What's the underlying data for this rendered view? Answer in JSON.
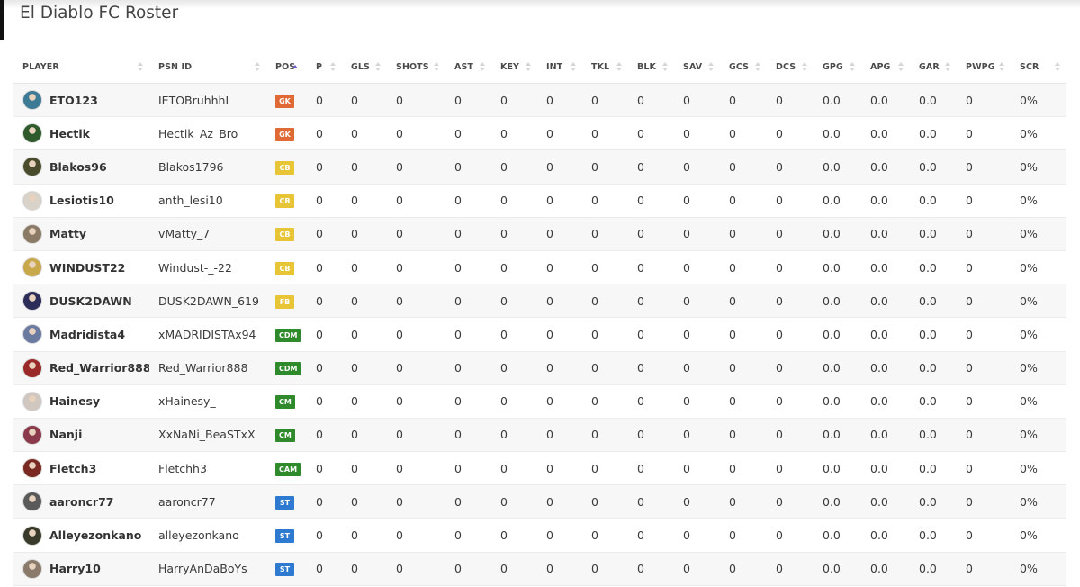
{
  "page": {
    "title": "El Diablo FC Roster"
  },
  "columns": {
    "player": "PLAYER",
    "psn": "PSN ID",
    "pos": "POS",
    "p": "P",
    "gls": "GLS",
    "shots": "SHOTS",
    "ast": "AST",
    "key": "KEY",
    "int": "INT",
    "tkl": "TKL",
    "blk": "BLK",
    "sav": "SAV",
    "gcs": "GCS",
    "dcs": "DCS",
    "gpg": "GPG",
    "apg": "APG",
    "gar": "GAR",
    "pwpg": "PWPG",
    "scr": "SCR"
  },
  "sort": {
    "column": "POS",
    "direction": "ascending"
  },
  "position_colors": {
    "GK": "#e06a35",
    "CB": "#e8c537",
    "FB": "#e8c537",
    "CDM": "#2f8a2b",
    "CM": "#2f8a2b",
    "CAM": "#2f8a2b",
    "ST": "#2e7ad0"
  },
  "players": [
    {
      "name": "ETO123",
      "psn": "IETOBruhhhI",
      "pos": "GK",
      "avatar_color": "#3d7a95",
      "p": "0",
      "gls": "0",
      "shots": "0",
      "ast": "0",
      "key": "0",
      "int": "0",
      "tkl": "0",
      "blk": "0",
      "sav": "0",
      "gcs": "0",
      "dcs": "0",
      "gpg": "0.0",
      "apg": "0.0",
      "gar": "0.0",
      "pwpg": "0",
      "scr": "0%"
    },
    {
      "name": "Hectik",
      "psn": "Hectik_Az_Bro",
      "pos": "GK",
      "avatar_color": "#2f5a2c",
      "p": "0",
      "gls": "0",
      "shots": "0",
      "ast": "0",
      "key": "0",
      "int": "0",
      "tkl": "0",
      "blk": "0",
      "sav": "0",
      "gcs": "0",
      "dcs": "0",
      "gpg": "0.0",
      "apg": "0.0",
      "gar": "0.0",
      "pwpg": "0",
      "scr": "0%"
    },
    {
      "name": "Blakos96",
      "psn": "Blakos1796",
      "pos": "CB",
      "avatar_color": "#4a4a2c",
      "p": "0",
      "gls": "0",
      "shots": "0",
      "ast": "0",
      "key": "0",
      "int": "0",
      "tkl": "0",
      "blk": "0",
      "sav": "0",
      "gcs": "0",
      "dcs": "0",
      "gpg": "0.0",
      "apg": "0.0",
      "gar": "0.0",
      "pwpg": "0",
      "scr": "0%"
    },
    {
      "name": "Lesiotis10",
      "psn": "anth_lesi10",
      "pos": "CB",
      "avatar_color": "#d8d2c8",
      "p": "0",
      "gls": "0",
      "shots": "0",
      "ast": "0",
      "key": "0",
      "int": "0",
      "tkl": "0",
      "blk": "0",
      "sav": "0",
      "gcs": "0",
      "dcs": "0",
      "gpg": "0.0",
      "apg": "0.0",
      "gar": "0.0",
      "pwpg": "0",
      "scr": "0%"
    },
    {
      "name": "Matty",
      "psn": "vMatty_7",
      "pos": "CB",
      "avatar_color": "#8a7a66",
      "p": "0",
      "gls": "0",
      "shots": "0",
      "ast": "0",
      "key": "0",
      "int": "0",
      "tkl": "0",
      "blk": "0",
      "sav": "0",
      "gcs": "0",
      "dcs": "0",
      "gpg": "0.0",
      "apg": "0.0",
      "gar": "0.0",
      "pwpg": "0",
      "scr": "0%"
    },
    {
      "name": "WINDUST22",
      "psn": "Windust-_-22",
      "pos": "CB",
      "avatar_color": "#c9a84a",
      "p": "0",
      "gls": "0",
      "shots": "0",
      "ast": "0",
      "key": "0",
      "int": "0",
      "tkl": "0",
      "blk": "0",
      "sav": "0",
      "gcs": "0",
      "dcs": "0",
      "gpg": "0.0",
      "apg": "0.0",
      "gar": "0.0",
      "pwpg": "0",
      "scr": "0%"
    },
    {
      "name": "DUSK2DAWN",
      "psn": "DUSK2DAWN_619",
      "pos": "FB",
      "avatar_color": "#2d2d5a",
      "p": "0",
      "gls": "0",
      "shots": "0",
      "ast": "0",
      "key": "0",
      "int": "0",
      "tkl": "0",
      "blk": "0",
      "sav": "0",
      "gcs": "0",
      "dcs": "0",
      "gpg": "0.0",
      "apg": "0.0",
      "gar": "0.0",
      "pwpg": "0",
      "scr": "0%"
    },
    {
      "name": "Madridista4",
      "psn": "xMADRIDISTAx94",
      "pos": "CDM",
      "avatar_color": "#6a7aa0",
      "p": "0",
      "gls": "0",
      "shots": "0",
      "ast": "0",
      "key": "0",
      "int": "0",
      "tkl": "0",
      "blk": "0",
      "sav": "0",
      "gcs": "0",
      "dcs": "0",
      "gpg": "0.0",
      "apg": "0.0",
      "gar": "0.0",
      "pwpg": "0",
      "scr": "0%"
    },
    {
      "name": "Red_Warrior888",
      "psn": "Red_Warrior888",
      "pos": "CDM",
      "avatar_color": "#9a2a2a",
      "p": "0",
      "gls": "0",
      "shots": "0",
      "ast": "0",
      "key": "0",
      "int": "0",
      "tkl": "0",
      "blk": "0",
      "sav": "0",
      "gcs": "0",
      "dcs": "0",
      "gpg": "0.0",
      "apg": "0.0",
      "gar": "0.0",
      "pwpg": "0",
      "scr": "0%"
    },
    {
      "name": "Hainesy",
      "psn": "xHainesy_",
      "pos": "CM",
      "avatar_color": "#d0c8c0",
      "p": "0",
      "gls": "0",
      "shots": "0",
      "ast": "0",
      "key": "0",
      "int": "0",
      "tkl": "0",
      "blk": "0",
      "sav": "0",
      "gcs": "0",
      "dcs": "0",
      "gpg": "0.0",
      "apg": "0.0",
      "gar": "0.0",
      "pwpg": "0",
      "scr": "0%"
    },
    {
      "name": "Nanji",
      "psn": "XxNaNi_BeaSTxX",
      "pos": "CM",
      "avatar_color": "#8a3a4a",
      "p": "0",
      "gls": "0",
      "shots": "0",
      "ast": "0",
      "key": "0",
      "int": "0",
      "tkl": "0",
      "blk": "0",
      "sav": "0",
      "gcs": "0",
      "dcs": "0",
      "gpg": "0.0",
      "apg": "0.0",
      "gar": "0.0",
      "pwpg": "0",
      "scr": "0%"
    },
    {
      "name": "Fletch3",
      "psn": "Fletchh3",
      "pos": "CAM",
      "avatar_color": "#7a2a22",
      "p": "0",
      "gls": "0",
      "shots": "0",
      "ast": "0",
      "key": "0",
      "int": "0",
      "tkl": "0",
      "blk": "0",
      "sav": "0",
      "gcs": "0",
      "dcs": "0",
      "gpg": "0.0",
      "apg": "0.0",
      "gar": "0.0",
      "pwpg": "0",
      "scr": "0%"
    },
    {
      "name": "aaroncr77",
      "psn": "aaroncr77",
      "pos": "ST",
      "avatar_color": "#5a5a5a",
      "p": "0",
      "gls": "0",
      "shots": "0",
      "ast": "0",
      "key": "0",
      "int": "0",
      "tkl": "0",
      "blk": "0",
      "sav": "0",
      "gcs": "0",
      "dcs": "0",
      "gpg": "0.0",
      "apg": "0.0",
      "gar": "0.0",
      "pwpg": "0",
      "scr": "0%"
    },
    {
      "name": "Alleyezonkano",
      "psn": "alleyezonkano",
      "pos": "ST",
      "avatar_color": "#3a3a2a",
      "p": "0",
      "gls": "0",
      "shots": "0",
      "ast": "0",
      "key": "0",
      "int": "0",
      "tkl": "0",
      "blk": "0",
      "sav": "0",
      "gcs": "0",
      "dcs": "0",
      "gpg": "0.0",
      "apg": "0.0",
      "gar": "0.0",
      "pwpg": "0",
      "scr": "0%"
    },
    {
      "name": "Harry10",
      "psn": "HarryAnDaBoYs",
      "pos": "ST",
      "avatar_color": "#8a7a6a",
      "p": "0",
      "gls": "0",
      "shots": "0",
      "ast": "0",
      "key": "0",
      "int": "0",
      "tkl": "0",
      "blk": "0",
      "sav": "0",
      "gcs": "0",
      "dcs": "0",
      "gpg": "0.0",
      "apg": "0.0",
      "gar": "0.0",
      "pwpg": "0",
      "scr": "0%"
    }
  ]
}
